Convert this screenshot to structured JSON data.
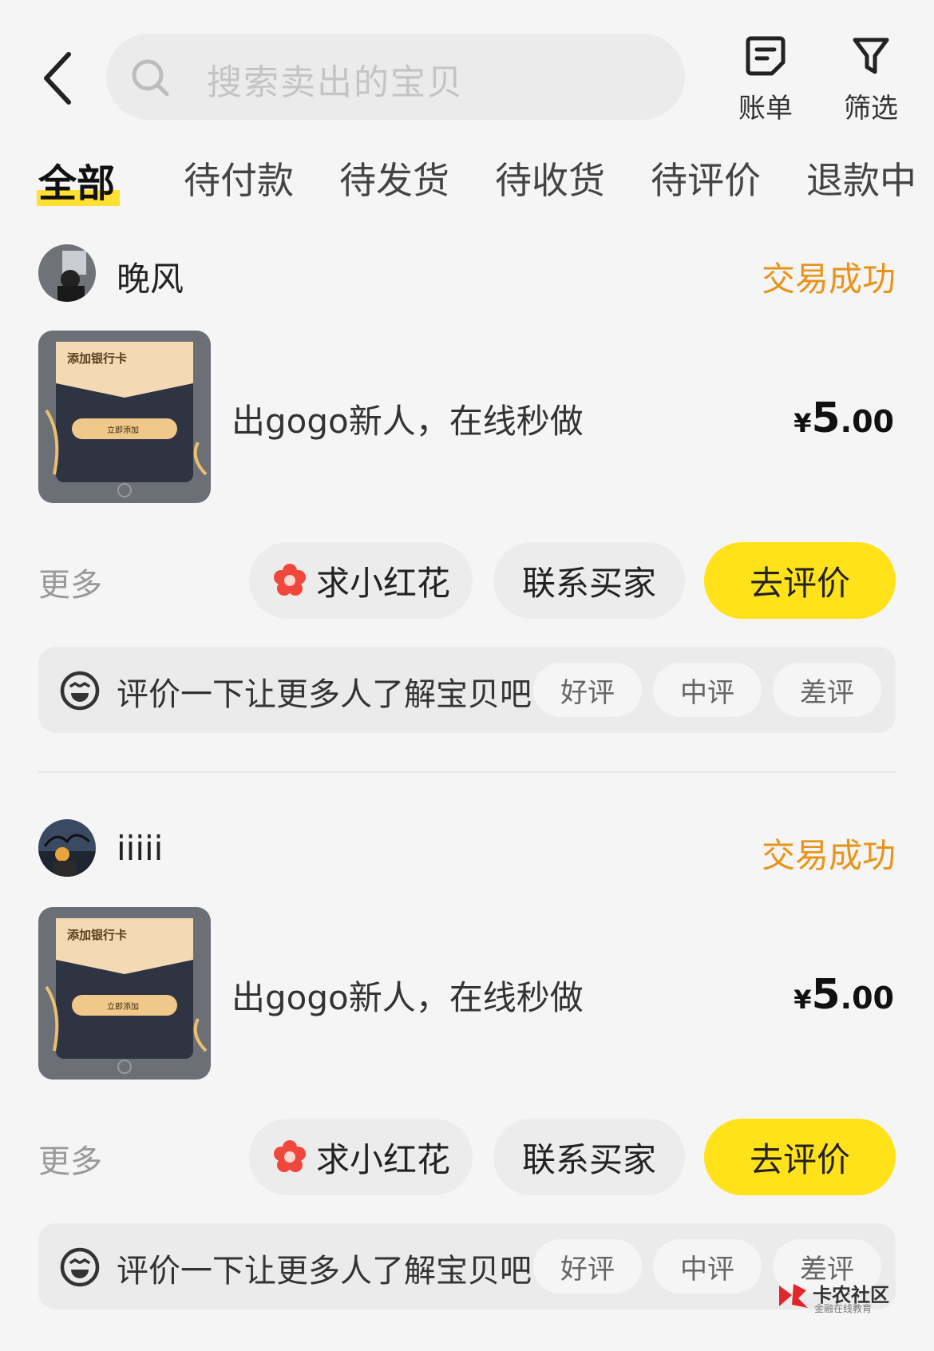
{
  "search": {
    "placeholder": "搜索卖出的宝贝"
  },
  "top_actions": {
    "bill_label": "账单",
    "filter_label": "筛选"
  },
  "tabs": [
    "全部",
    "待付款",
    "待发货",
    "待收货",
    "待评价",
    "退款中"
  ],
  "orders": [
    {
      "buyer": "晚风",
      "status": "交易成功",
      "title": "出gogo新人，在线秒做",
      "price": {
        "currency": "¥",
        "integer": "5",
        "decimal": ".00"
      },
      "thumb": {
        "card_title": "添加银行卡",
        "button": "立即添加"
      },
      "more": "更多",
      "btn_flower": "求小红花",
      "btn_contact": "联系买家",
      "btn_review": "去评价",
      "rate_prompt": "评价一下让更多人了解宝贝吧",
      "rate_good": "好评",
      "rate_mid": "中评",
      "rate_bad": "差评"
    },
    {
      "buyer": "iiiii",
      "status": "交易成功",
      "title": "出gogo新人，在线秒做",
      "price": {
        "currency": "¥",
        "integer": "5",
        "decimal": ".00"
      },
      "thumb": {
        "card_title": "添加银行卡",
        "button": "立即添加"
      },
      "more": "更多",
      "btn_flower": "求小红花",
      "btn_contact": "联系买家",
      "btn_review": "去评价",
      "rate_prompt": "评价一下让更多人了解宝贝吧",
      "rate_good": "好评",
      "rate_mid": "中评",
      "rate_bad": "差评"
    }
  ],
  "watermark": {
    "line1": "卡农社区",
    "line2": "金融在线教育"
  },
  "colors": {
    "accent_yellow": "#ffe21a",
    "status_orange": "#e8941a",
    "flower_red": "#f0473d"
  }
}
